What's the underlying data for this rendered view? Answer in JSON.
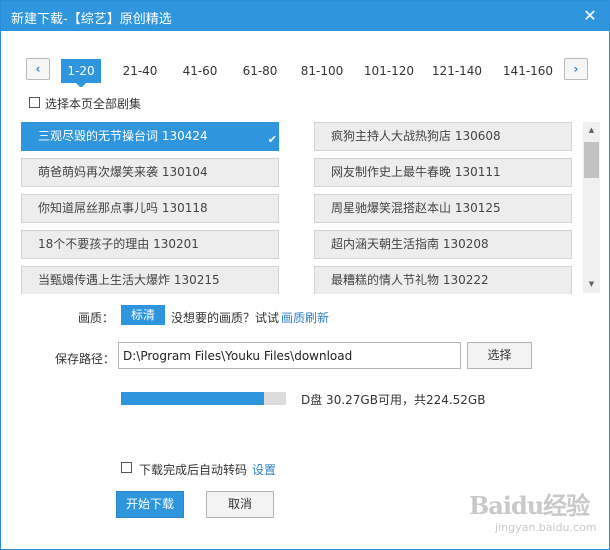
{
  "window": {
    "title": "新建下载-【综艺】原创精选",
    "close_glyph": "✕"
  },
  "nav": {
    "prev_glyph": "‹",
    "next_glyph": "›"
  },
  "ranges": [
    "1-20",
    "21-40",
    "41-60",
    "61-80",
    "81-100",
    "101-120",
    "121-140",
    "141-160"
  ],
  "active_range": "1-20",
  "select_all": {
    "label": "选择本页全部剧集",
    "checked": false
  },
  "episodes": [
    {
      "title": "三观尽毁的无节操台词 130424",
      "selected": true
    },
    {
      "title": "疯狗主持人大战热狗店 130608",
      "selected": false
    },
    {
      "title": "萌爸萌妈再次爆笑来袭 130104",
      "selected": false
    },
    {
      "title": "网友制作史上最牛春晚 130111",
      "selected": false
    },
    {
      "title": "你知道屌丝那点事儿吗 130118",
      "selected": false
    },
    {
      "title": "周星驰爆笑混搭赵本山 130125",
      "selected": false
    },
    {
      "title": "18个不要孩子的理由 130201",
      "selected": false
    },
    {
      "title": "超内涵天朝生活指南 130208",
      "selected": false
    },
    {
      "title": "当甄嬛传遇上生活大爆炸 130215",
      "selected": false
    },
    {
      "title": "最糟糕的情人节礼物 130222",
      "selected": false
    }
  ],
  "quality": {
    "label": "画质：",
    "value": "标清",
    "hint": "没想要的画质？试试",
    "link": "画质刷新"
  },
  "save_path": {
    "label": "保存路径：",
    "value": "D:\\Program Files\\Youku Files\\download",
    "button": "选择"
  },
  "disk": {
    "used_fraction": 0.865,
    "info": "D盘 30.27GB可用，共224.52GB"
  },
  "transcode": {
    "label": "下载完成后自动转码",
    "link": "设置",
    "checked": false
  },
  "buttons": {
    "start": "开始下载",
    "cancel": "取消"
  },
  "watermark": {
    "main": "Baidu经验",
    "sub": "jingyan.baidu.com"
  },
  "colors": {
    "accent": "#2f95dd",
    "link": "#2f80c8"
  }
}
